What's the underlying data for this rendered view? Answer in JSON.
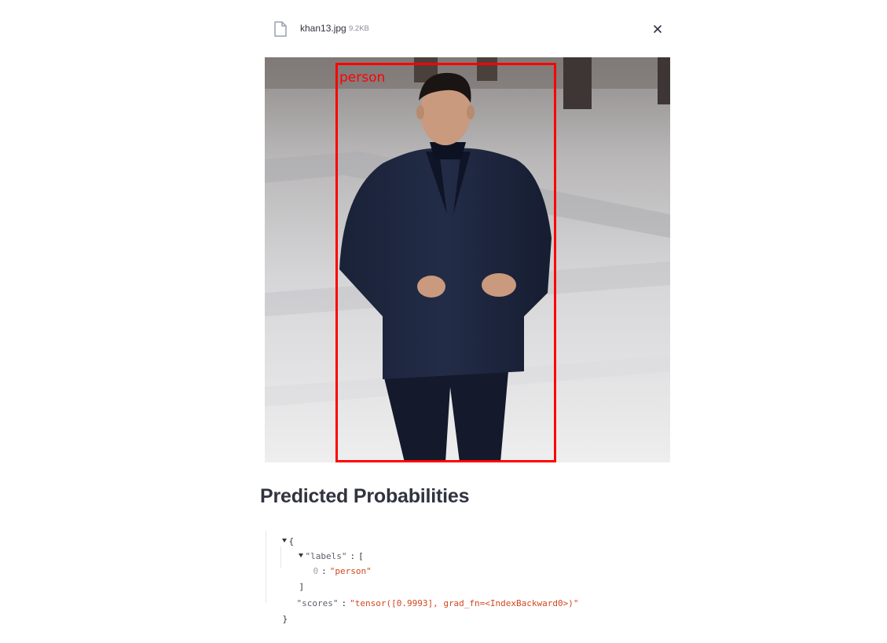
{
  "file": {
    "name": "khan13.jpg",
    "size": "9.2KB",
    "icon": "document-icon",
    "close_icon": "close-icon"
  },
  "image": {
    "description_icon": "detection-result-image",
    "bbox_label": "person",
    "bbox_color": "#ff0000"
  },
  "section": {
    "title": "Predicted Probabilities"
  },
  "json_output": {
    "open_brace": "{",
    "close_brace": "}",
    "labels_key": "\"labels\"",
    "labels_open": "[",
    "labels_close": "]",
    "labels_items": [
      {
        "index": "0",
        "value": "\"person\""
      }
    ],
    "scores_key": "\"scores\"",
    "scores_value": "\"tensor([0.9993], grad_fn=<IndexBackward0>)\""
  },
  "colors": {
    "text": "#31333f",
    "string_value": "#d0481f",
    "key": "#5c5f6b",
    "accent_red": "#ff0000"
  }
}
